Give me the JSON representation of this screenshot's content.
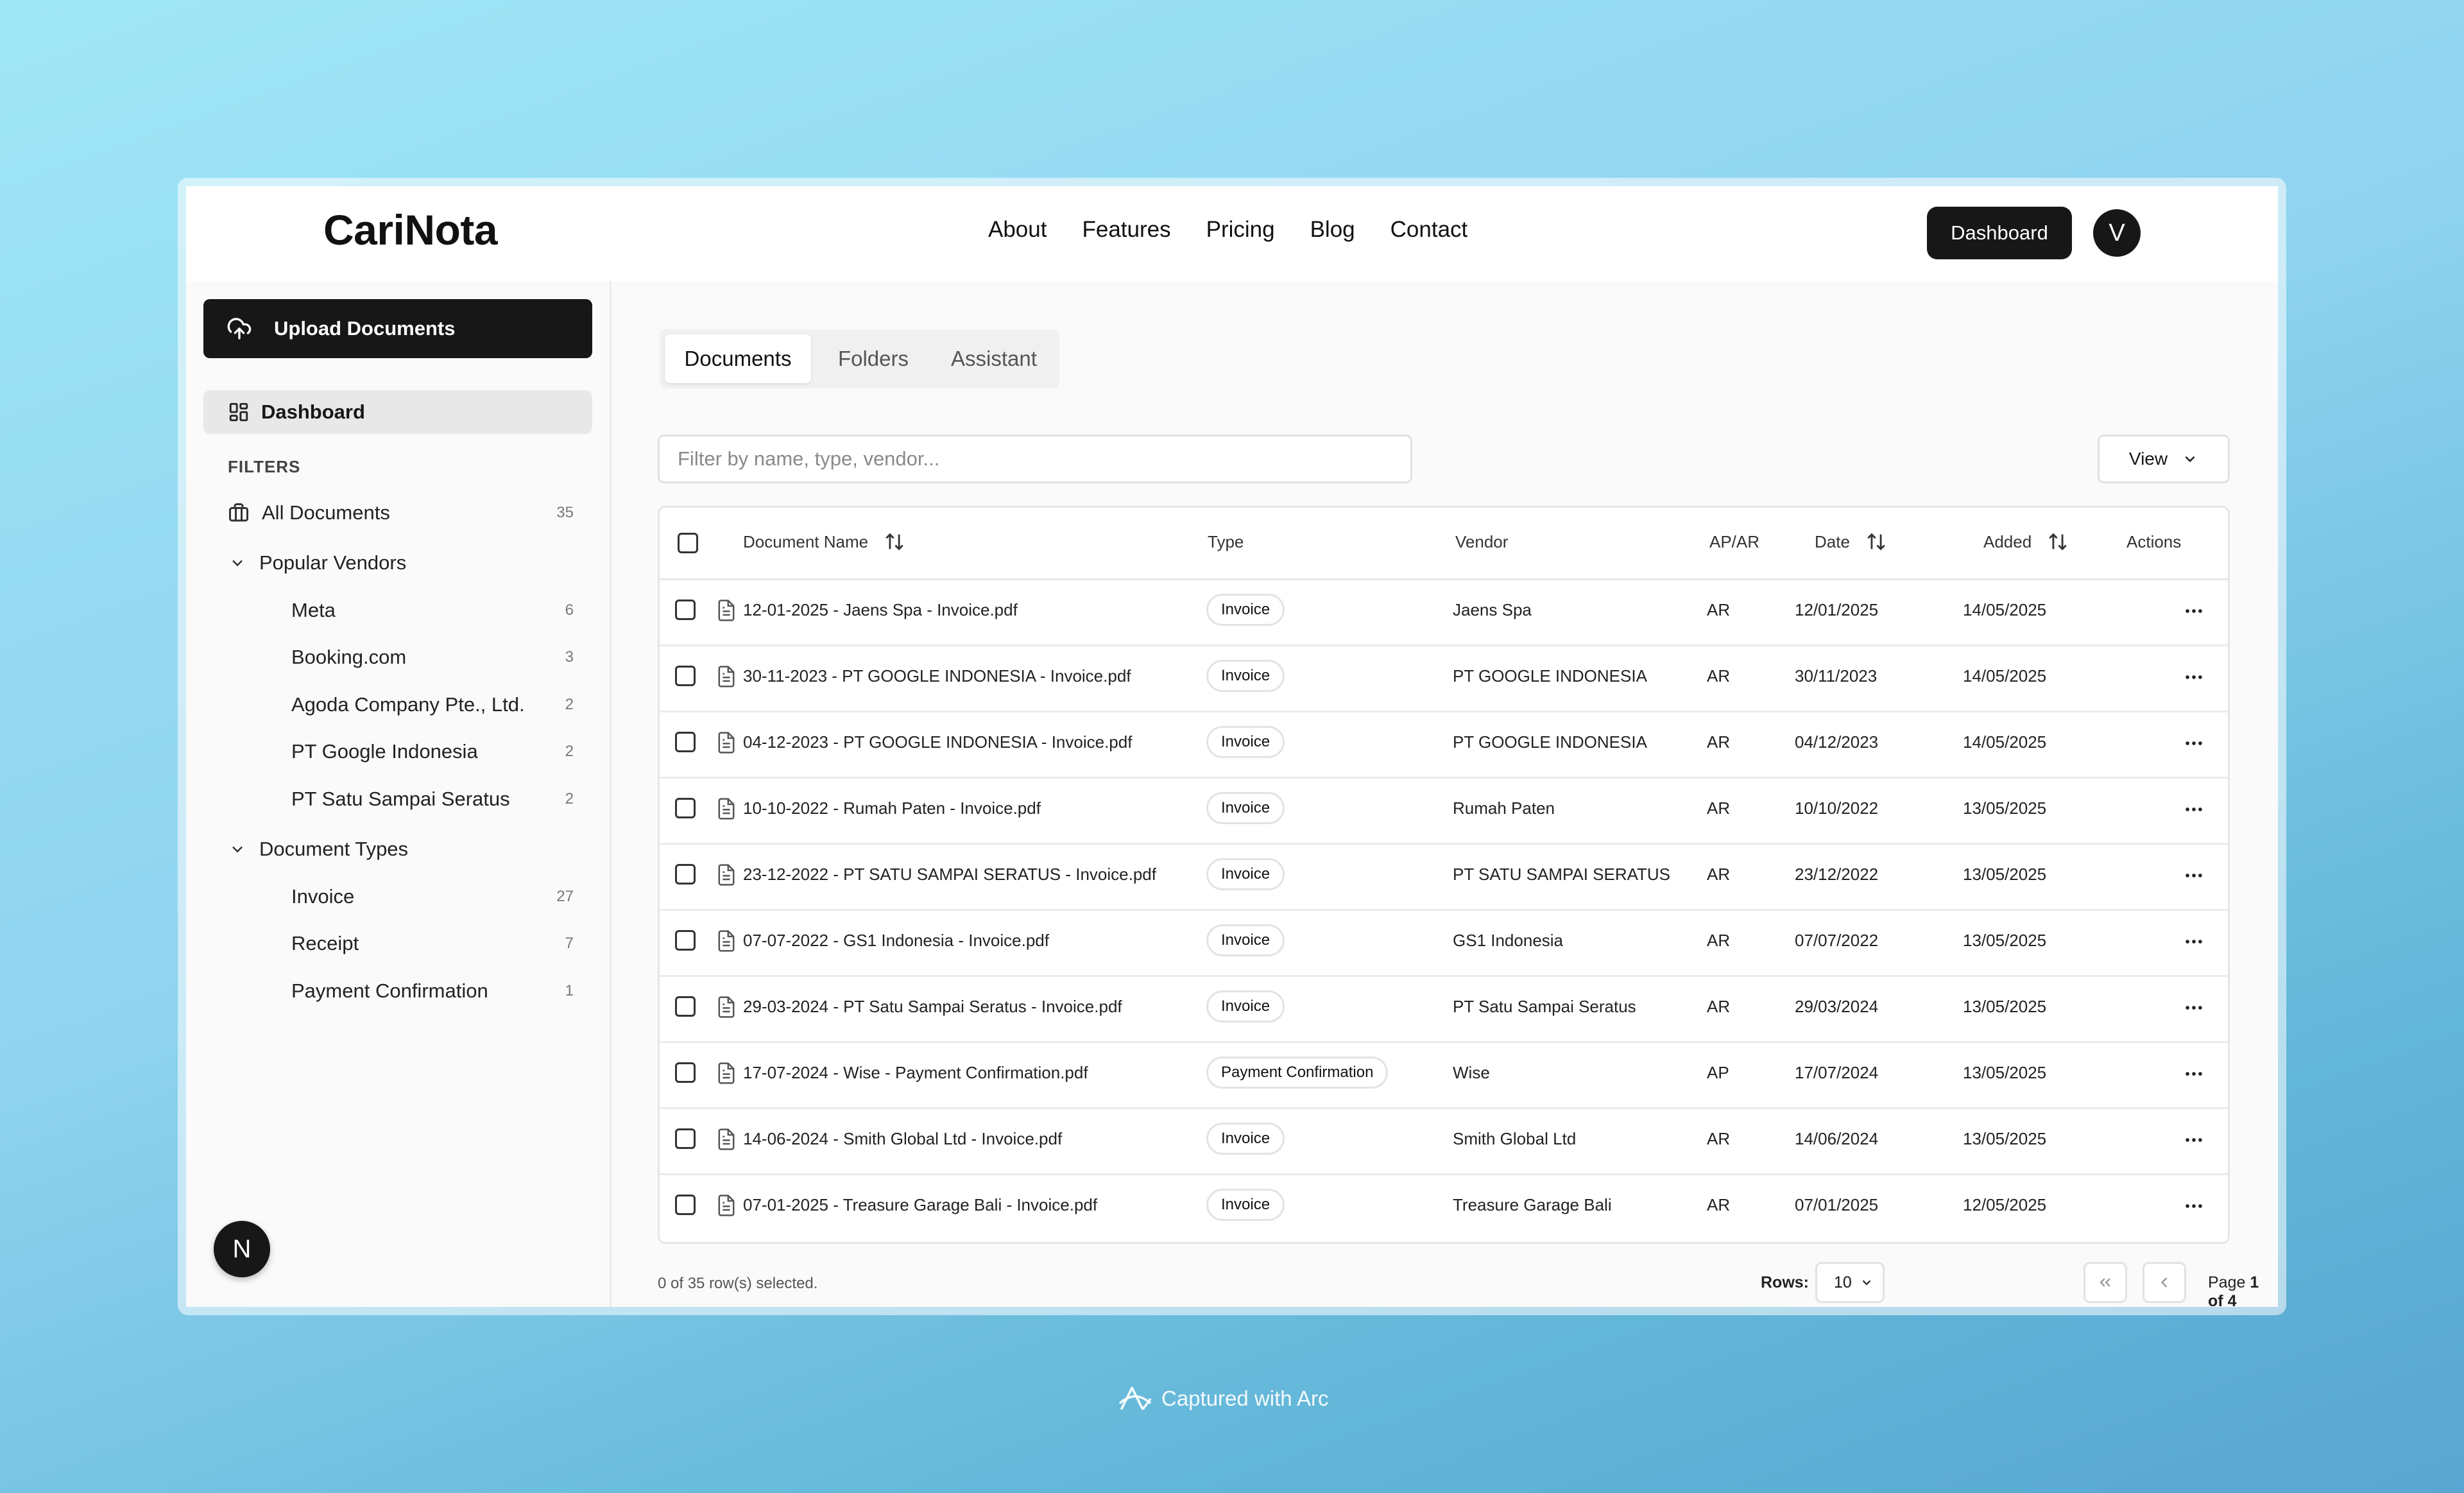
{
  "app": {
    "logo": "CariNota",
    "nav": [
      "About",
      "Features",
      "Pricing",
      "Blog",
      "Contact"
    ],
    "dashboard_button": "Dashboard",
    "avatar_letter": "V"
  },
  "sidebar": {
    "upload_label": "Upload Documents",
    "dashboard_label": "Dashboard",
    "filters_title": "FILTERS",
    "all_documents": {
      "label": "All Documents",
      "count": "35"
    },
    "vendors_section": "Popular Vendors",
    "vendors": [
      {
        "label": "Meta",
        "count": "6"
      },
      {
        "label": "Booking.com",
        "count": "3"
      },
      {
        "label": "Agoda Company Pte., Ltd.",
        "count": "2"
      },
      {
        "label": "PT Google Indonesia",
        "count": "2"
      },
      {
        "label": "PT Satu Sampai Seratus",
        "count": "2"
      }
    ],
    "types_section": "Document Types",
    "types": [
      {
        "label": "Invoice",
        "count": "27"
      },
      {
        "label": "Receipt",
        "count": "7"
      },
      {
        "label": "Payment Confirmation",
        "count": "1"
      }
    ],
    "fab_letter": "N"
  },
  "main": {
    "tabs": [
      "Documents",
      "Folders",
      "Assistant"
    ],
    "active_tab": "Documents",
    "filter_placeholder": "Filter by name, type, vendor...",
    "view_label": "View",
    "columns": {
      "name": "Document Name",
      "type": "Type",
      "vendor": "Vendor",
      "apar": "AP/AR",
      "date": "Date",
      "added": "Added",
      "actions": "Actions"
    },
    "rows": [
      {
        "name": "12-01-2025 - Jaens Spa - Invoice.pdf",
        "type": "Invoice",
        "vendor": "Jaens Spa",
        "apar": "AR",
        "date": "12/01/2025",
        "added": "14/05/2025"
      },
      {
        "name": "30-11-2023 - PT GOOGLE INDONESIA - Invoice.pdf",
        "type": "Invoice",
        "vendor": "PT GOOGLE INDONESIA",
        "apar": "AR",
        "date": "30/11/2023",
        "added": "14/05/2025"
      },
      {
        "name": "04-12-2023 - PT GOOGLE INDONESIA - Invoice.pdf",
        "type": "Invoice",
        "vendor": "PT GOOGLE INDONESIA",
        "apar": "AR",
        "date": "04/12/2023",
        "added": "14/05/2025"
      },
      {
        "name": "10-10-2022 - Rumah Paten - Invoice.pdf",
        "type": "Invoice",
        "vendor": "Rumah Paten",
        "apar": "AR",
        "date": "10/10/2022",
        "added": "13/05/2025"
      },
      {
        "name": "23-12-2022 - PT SATU SAMPAI SERATUS - Invoice.pdf",
        "type": "Invoice",
        "vendor": "PT SATU SAMPAI SERATUS",
        "apar": "AR",
        "date": "23/12/2022",
        "added": "13/05/2025"
      },
      {
        "name": "07-07-2022 - GS1 Indonesia - Invoice.pdf",
        "type": "Invoice",
        "vendor": "GS1 Indonesia",
        "apar": "AR",
        "date": "07/07/2022",
        "added": "13/05/2025"
      },
      {
        "name": "29-03-2024 - PT Satu Sampai Seratus - Invoice.pdf",
        "type": "Invoice",
        "vendor": "PT Satu Sampai Seratus",
        "apar": "AR",
        "date": "29/03/2024",
        "added": "13/05/2025"
      },
      {
        "name": "17-07-2024 - Wise - Payment Confirmation.pdf",
        "type": "Payment Confirmation",
        "vendor": "Wise",
        "apar": "AP",
        "date": "17/07/2024",
        "added": "13/05/2025"
      },
      {
        "name": "14-06-2024 - Smith Global Ltd - Invoice.pdf",
        "type": "Invoice",
        "vendor": "Smith Global Ltd",
        "apar": "AR",
        "date": "14/06/2024",
        "added": "13/05/2025"
      },
      {
        "name": "07-01-2025 - Treasure Garage Bali - Invoice.pdf",
        "type": "Invoice",
        "vendor": "Treasure Garage Bali",
        "apar": "AR",
        "date": "07/01/2025",
        "added": "12/05/2025"
      }
    ],
    "selection_text": "0 of 35 row(s) selected.",
    "rows_label": "Rows:",
    "rows_value": "10",
    "page_prefix": "Page",
    "page_current": "1",
    "page_of": "of",
    "page_total": "4"
  },
  "captured_text": "Captured with Arc"
}
